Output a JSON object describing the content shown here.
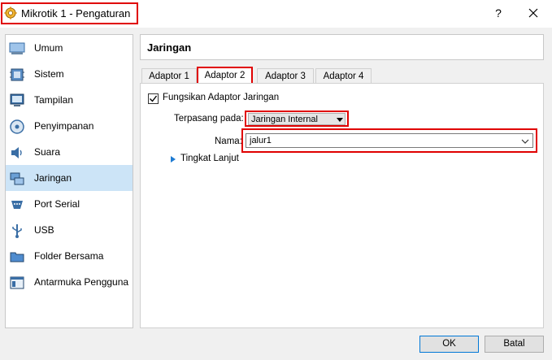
{
  "window": {
    "title": "Mikrotik 1 - Pengaturan",
    "help_label": "?"
  },
  "sidebar": {
    "items": [
      {
        "label": "Umum",
        "icon": "general-icon"
      },
      {
        "label": "Sistem",
        "icon": "system-icon"
      },
      {
        "label": "Tampilan",
        "icon": "display-icon"
      },
      {
        "label": "Penyimpanan",
        "icon": "storage-icon"
      },
      {
        "label": "Suara",
        "icon": "audio-icon"
      },
      {
        "label": "Jaringan",
        "icon": "network-icon",
        "active": true
      },
      {
        "label": "Port Serial",
        "icon": "serial-port-icon"
      },
      {
        "label": "USB",
        "icon": "usb-icon"
      },
      {
        "label": "Folder Bersama",
        "icon": "shared-folder-icon"
      },
      {
        "label": "Antarmuka Pengguna",
        "icon": "user-interface-icon"
      }
    ]
  },
  "main": {
    "title": "Jaringan",
    "tabs": [
      {
        "label": "Adaptor 1"
      },
      {
        "label": "Adaptor 2",
        "active": true
      },
      {
        "label": "Adaptor 3"
      },
      {
        "label": "Adaptor 4"
      }
    ],
    "enable_adapter": {
      "label": "Fungsikan Adaptor Jaringan",
      "checked": true
    },
    "attached_to": {
      "label": "Terpasang pada:",
      "value": "Jaringan Internal"
    },
    "name": {
      "label": "Nama:",
      "value": "jalur1"
    },
    "advanced": {
      "label": "Tingkat Lanjut"
    }
  },
  "footer": {
    "ok_label": "OK",
    "cancel_label": "Batal"
  },
  "colors": {
    "highlight_red": "#e00000",
    "selection_blue": "#cce4f7",
    "accent_blue": "#1e7bd2"
  }
}
